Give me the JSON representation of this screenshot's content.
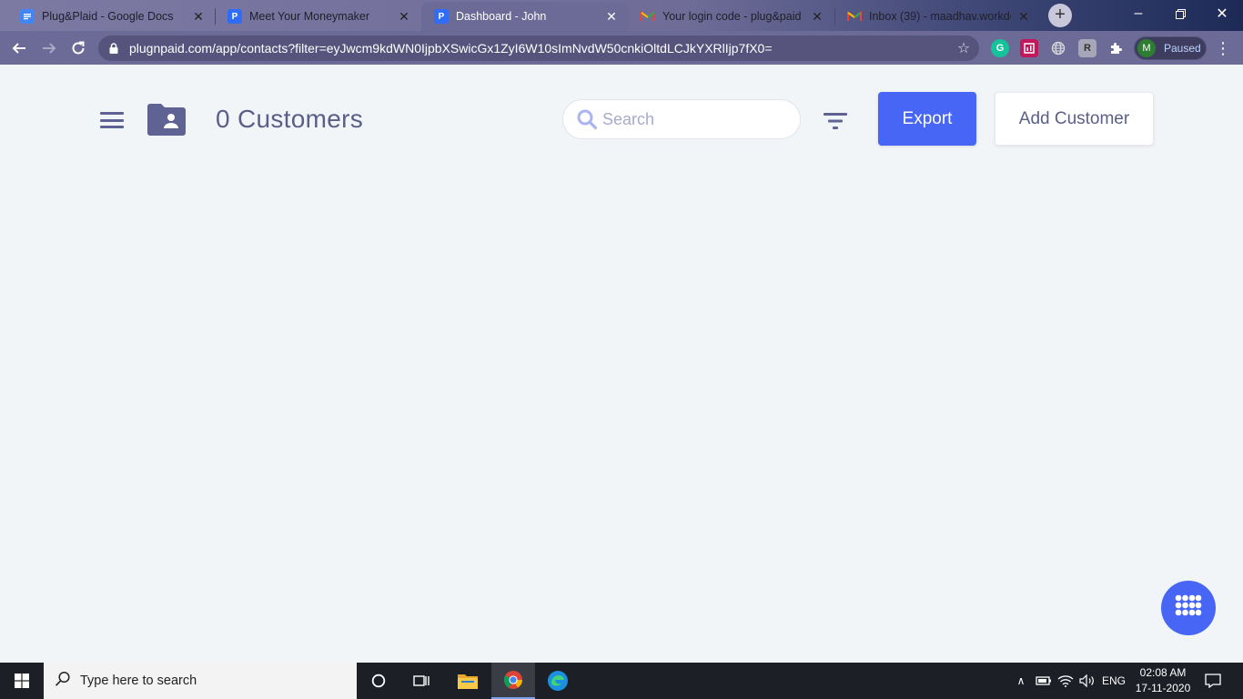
{
  "browser": {
    "tabs": [
      {
        "title": "Plug&Plaid - Google Docs",
        "favicon": "google-docs-icon",
        "active": false
      },
      {
        "title": "Meet Your Moneymaker",
        "favicon": "plugnpaid-icon",
        "active": false
      },
      {
        "title": "Dashboard - John",
        "favicon": "plugnpaid-icon",
        "active": true
      },
      {
        "title": "Your login code - plug&paid -",
        "favicon": "gmail-icon",
        "active": false
      },
      {
        "title": "Inbox (39) - maadhav.workdoc",
        "favicon": "gmail-icon",
        "active": false
      }
    ],
    "url": "plugnpaid.com/app/contacts?filter=eyJwcm9kdWN0IjpbXSwicGx1ZyI6W10sImNvdW50cnkiOltdLCJkYXRlIjp7fX0=",
    "profile": {
      "initial": "M",
      "status": "Paused"
    },
    "colors": {
      "chrome": "#6c6a96",
      "accent": "#4866f5"
    }
  },
  "page": {
    "customer_count": "0 Customers",
    "search_placeholder": "Search",
    "export_label": "Export",
    "add_customer_label": "Add Customer"
  },
  "taskbar": {
    "search_text": "Type here to search",
    "language": "ENG",
    "time": "02:08 AM",
    "date": "17-11-2020"
  }
}
